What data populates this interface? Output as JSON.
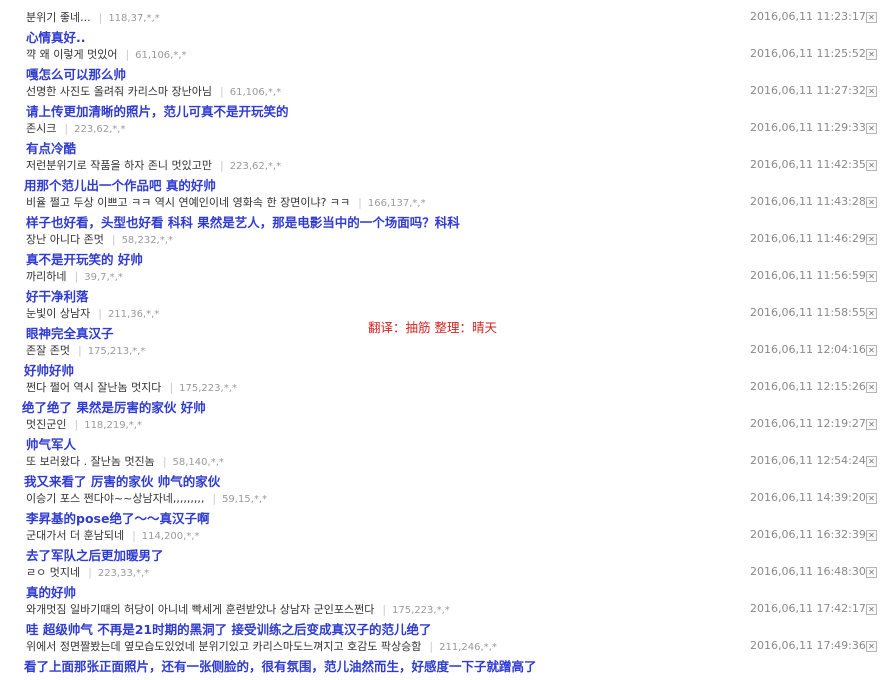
{
  "credit": "翻译：抽筋  整理：晴天",
  "delete_icon": "close-icon",
  "comments": [
    {
      "text": "분위기 좋네...",
      "ip": "118,37,*,*",
      "date": "2016,06,11 11:23:17",
      "translation": "心情真好.."
    },
    {
      "text": "꺅 왜 이렇게 멋있어",
      "ip": "61,106,*,*",
      "date": "2016,06,11 11:25:52",
      "translation": "嘎怎么可以那么帅"
    },
    {
      "text": "선명한 사진도 올려줘 카리스마 장난아님",
      "ip": "61,106,*,*",
      "date": "2016,06,11 11:27:32",
      "translation": "请上传更加清晰的照片，范儿可真不是开玩笑的"
    },
    {
      "text": "존시크",
      "ip": "223,62,*,*",
      "date": "2016,06,11 11:29:33",
      "translation": "有点冷酷"
    },
    {
      "text": "저런분위기로 작품을 하자 존니 멋있고만",
      "ip": "223,62,*,*",
      "date": "2016,06,11 11:42:35",
      "translation": "用那个范儿出一个作品吧 真的好帅"
    },
    {
      "text": "비율 쩔고 두상 이쁘고 ㅋㅋ 역시 연예인이네 영화속 한 장면이냐? ㅋㅋ",
      "ip": "166,137,*,*",
      "date": "2016,06,11 11:43:28",
      "translation": "样子也好看，头型也好看 科科 果然是艺人，那是电影当中的一个场面吗？科科"
    },
    {
      "text": "장난 아니다 존멋",
      "ip": "58,232,*,*",
      "date": "2016,06,11 11:46:29",
      "translation": "真不是开玩笑的 好帅"
    },
    {
      "text": "까리하네",
      "ip": "39,7,*,*",
      "date": "2016,06,11 11:56:59",
      "translation": "好干净利落"
    },
    {
      "text": "눈빛이 상남자",
      "ip": "211,36,*,*",
      "date": "2016,06,11 11:58:55",
      "translation": "眼神完全真汉子"
    },
    {
      "text": "존잘 존멋",
      "ip": "175,213,*,*",
      "date": "2016,06,11 12:04:16",
      "translation": "好帅好帅"
    },
    {
      "text": "쩐다 쩔어 역시 잘난놈 멋지다",
      "ip": "175,223,*,*",
      "date": "2016,06,11 12:15:26",
      "translation": "绝了绝了 果然是厉害的家伙 好帅"
    },
    {
      "text": "멋진군인",
      "ip": "118,219,*,*",
      "date": "2016,06,11 12:19:27",
      "translation": "帅气军人"
    },
    {
      "text": "또 보러왔다 . 잘난놈 멋진놈",
      "ip": "58,140,*,*",
      "date": "2016,06,11 12:54:24",
      "translation": "我又来看了 厉害的家伙 帅气的家伙"
    },
    {
      "text": "이승기 포스 쩐다야~~상남자네,,,,,,,,,",
      "ip": "59,15,*,*",
      "date": "2016,06,11 14:39:20",
      "translation": "李昇基的pose绝了～～真汉子啊"
    },
    {
      "text": "군대가서 더 훈남되네",
      "ip": "114,200,*,*",
      "date": "2016,06,11 16:32:39",
      "translation": "去了军队之后更加暖男了"
    },
    {
      "text": "ㄹㅇ 멋지네",
      "ip": "223,33,*,*",
      "date": "2016,06,11 16:48:30",
      "translation": "真的好帅"
    },
    {
      "text": "와개멋짐 일바기때의 허당이 아니네 빡세게 훈련받았나 상남자 군인포스쩐다",
      "ip": "175,223,*,*",
      "date": "2016,06,11 17:42:17",
      "translation": "哇 超级帅气 不再是21时期的黑洞了  接受训练之后变成真汉子的范儿绝了"
    },
    {
      "text": "위에서 정면짤봤는데 옆모습도있었네 분위기있고 카리스마도느껴지고 호감도 팍상승함",
      "ip": "211,246,*,*",
      "date": "2016,06,11 17:49:36",
      "translation": "看了上面那张正面照片，还有一张侧脸的，很有氛围，范儿油然而生，好感度一下子就蹭高了"
    }
  ]
}
